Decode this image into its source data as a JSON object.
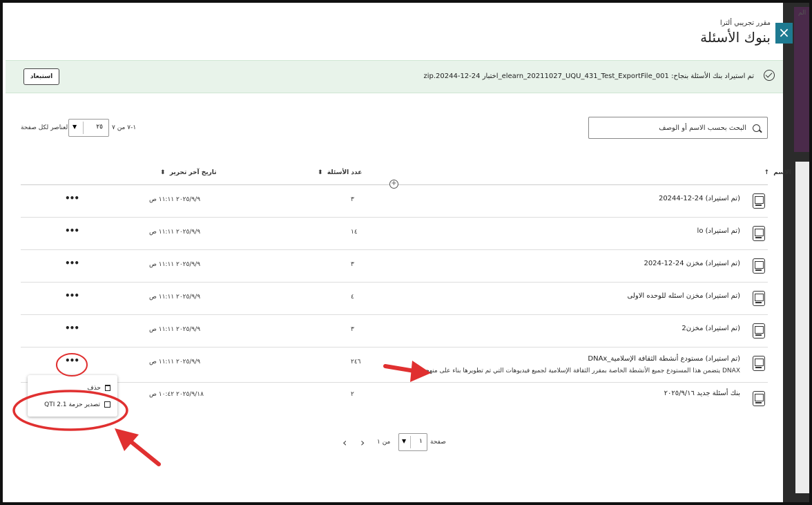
{
  "dialog": {
    "subtitle": "مقرر تجريبي ألترا",
    "title": "بنوك الأسئلة",
    "close_label": "×"
  },
  "success": {
    "message": "تم استيراد بنك الأسئلة بنجاح: 001_elearn_20211027_UQU_431_Test_ExportFile_اختبار 24-12-20244.zip",
    "dismiss_label": "استبعاد"
  },
  "search": {
    "placeholder": "البحث بحسب الاسم أو الوصف"
  },
  "pagination_top": {
    "per_page_label": "العناصر لكل صفحة",
    "per_page_value": "٢٥",
    "range_text": "١-٧ من ٧"
  },
  "table": {
    "headers": {
      "name": "الاسم",
      "count": "عدد الأسئلة",
      "date": "تاريخ آخر تحرير"
    },
    "rows": [
      {
        "name": "(تم استيراد) 24-12-20244",
        "desc": "",
        "count": "٣",
        "date": "٢٠٢٥/٩/٩ ١١:١١ ص"
      },
      {
        "name": "(تم استيراد) lo",
        "desc": "",
        "count": "١٤",
        "date": "٢٠٢٥/٩/٩ ١١:١١ ص"
      },
      {
        "name": "(تم استيراد) مخزن 24-12-2024",
        "desc": "",
        "count": "٣",
        "date": "٢٠٢٥/٩/٩ ١١:١١ ص"
      },
      {
        "name": "(تم استيراد) مخزن اسئله للوحده الاولى",
        "desc": "",
        "count": "٤",
        "date": "٢٠٢٥/٩/٩ ١١:١١ ص"
      },
      {
        "name": "(تم استيراد) مخزن2",
        "desc": "",
        "count": "٣",
        "date": "٢٠٢٥/٩/٩ ١١:١١ ص"
      },
      {
        "name": "(تم استيراد) مستودع أنشطة الثقافة الإسلامية_DNAx",
        "desc": "DNAX يتضمن هذا المستودع جميع الأنشطة الخاصة بمقرر الثقافة الإسلامية لجميع فيديوهات التي تم تطويرها بناء على منهجية...",
        "count": "٢٤٦",
        "date": "٢٠٢٥/٩/٩ ١١:١١ ص"
      },
      {
        "name": "بنك أسئلة جديد ٢٠٢٥/٩/١٦",
        "desc": "",
        "count": "٢",
        "date": "٢٠٢٥/٩/١٨ ١٠:٤٢ ص"
      }
    ],
    "actions_label": "•••"
  },
  "context_menu": {
    "delete_label": "حذف",
    "export_label": "تصدير حزمة QTI 2.1"
  },
  "pagination_bottom": {
    "page_label": "صفحة",
    "page_value": "١",
    "of_text": "من ١",
    "prev_label": "‹",
    "next_label": "›"
  },
  "right_panel": {
    "fragment": "الم"
  },
  "colors": {
    "success_bg": "#e8f3ea",
    "close_bg": "#1e7a91",
    "annotation_red": "#e03030"
  }
}
